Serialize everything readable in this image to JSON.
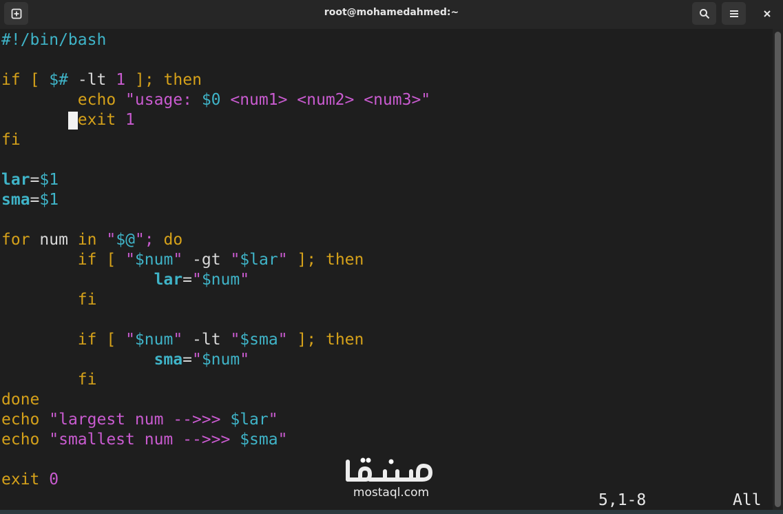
{
  "window": {
    "title": "root@mohamedahmed:~"
  },
  "icons": {
    "new_tab": "new-tab-icon",
    "search": "search-icon",
    "menu": "hamburger-menu-icon",
    "close": "close-icon"
  },
  "colors": {
    "keyword": "#d5a11a",
    "string": "#c95bd0",
    "variable": "#3fb4c8",
    "text": "#d8d8d8",
    "background": "#1e1e1e"
  },
  "code": {
    "shebang": "#!/bin/bash",
    "if": "if",
    "lbr": "[",
    "argc": "$#",
    "lt": "-lt",
    "one": "1",
    "rbr_semi": "];",
    "then": "then",
    "echo": "echo",
    "usage_q": "\"usage: ",
    "dollar0": "$0",
    "usage_rest": " <num1> <num2> <num3>\"",
    "exit": "exit",
    "fi": "fi",
    "lar": "lar",
    "sma": "sma",
    "eq": "=",
    "dollar1": "$1",
    "for": "for",
    "num": "num",
    "in": "in",
    "q_open": "\"",
    "all_args": "$@",
    "q_semi": "\";",
    "do": "do",
    "q": "\"",
    "dnum": "$num",
    "gt": "-gt",
    "dlar": "$lar",
    "dsma": "$sma",
    "done": "done",
    "largest_str": "\"largest num -->>> ",
    "smallest_str": "\"smallest num -->>> ",
    "zero": "0"
  },
  "status": {
    "position": "5,1-8",
    "scroll": "All"
  },
  "watermark": {
    "text": "mostaql.com"
  }
}
